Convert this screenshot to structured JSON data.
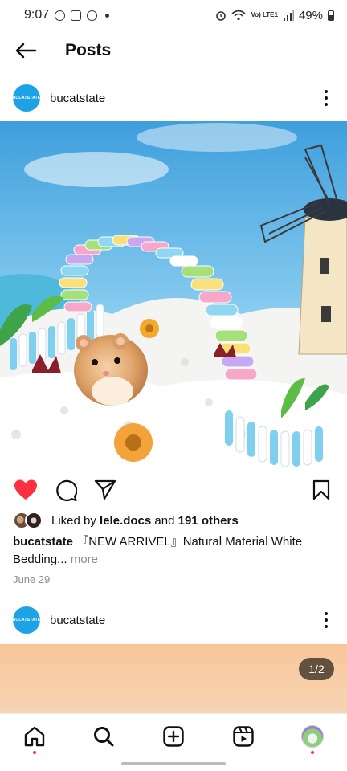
{
  "status": {
    "time": "9:07",
    "network": "Vo) LTE1",
    "battery": "49%"
  },
  "header": {
    "title": "Posts"
  },
  "posts": [
    {
      "username": "bucatstate",
      "avatar_text": "BUCATSTATE",
      "likes": {
        "prefix": "Liked by ",
        "user": "lele.docs",
        "middle": " and ",
        "others": "191 others"
      },
      "caption": {
        "username": "bucatstate",
        "text": " 『NEW ARRIVEL』Natural Material White Bedding...",
        "more": " more"
      },
      "date": "June 29",
      "liked": true
    },
    {
      "username": "bucatstate",
      "avatar_text": "BUCATSTATE",
      "image_counter": "1/2"
    }
  ],
  "nav": [
    "home-icon",
    "search-icon",
    "create-icon",
    "reels-icon",
    "profile"
  ],
  "colors": {
    "brand_blue": "#1da2e6",
    "like_red": "#ff3040",
    "notification_dot": "#ff2d55"
  }
}
